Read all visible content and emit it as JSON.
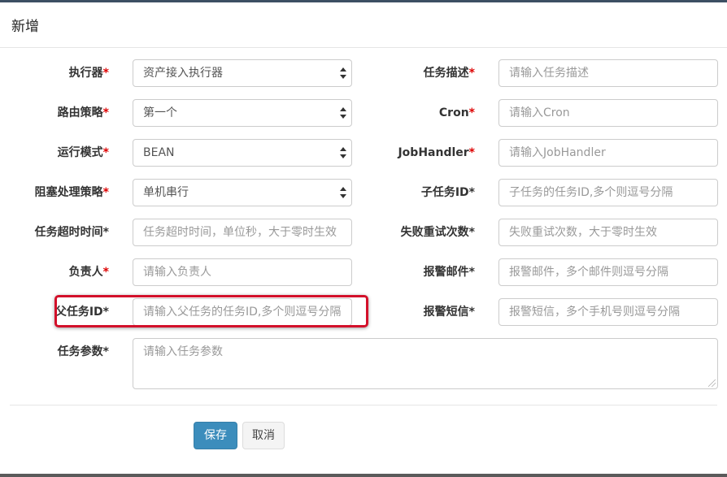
{
  "modal": {
    "title": "新增"
  },
  "required_mark": "*",
  "form": {
    "executor": {
      "label": "执行器",
      "value": "资产接入执行器"
    },
    "route_strategy": {
      "label": "路由策略",
      "value": "第一个"
    },
    "run_mode": {
      "label": "运行模式",
      "value": "BEAN"
    },
    "block_strategy": {
      "label": "阻塞处理策略",
      "value": "单机串行"
    },
    "timeout": {
      "label": "任务超时时间",
      "placeholder": "任务超时时间，单位秒，大于零时生效"
    },
    "owner": {
      "label": "负责人",
      "placeholder": "请输入负责人"
    },
    "parent_task_id": {
      "label": "父任务ID",
      "placeholder": "请输入父任务的任务ID,多个则逗号分隔"
    },
    "task_params": {
      "label": "任务参数",
      "placeholder": "请输入任务参数"
    },
    "task_desc": {
      "label": "任务描述",
      "placeholder": "请输入任务描述"
    },
    "cron": {
      "label": "Cron",
      "placeholder": "请输入Cron"
    },
    "job_handler": {
      "label": "JobHandler",
      "placeholder": "请输入JobHandler"
    },
    "child_task_id": {
      "label": "子任务ID",
      "placeholder": "子任务的任务ID,多个则逗号分隔"
    },
    "retry_count": {
      "label": "失败重试次数",
      "placeholder": "失败重试次数，大于零时生效"
    },
    "alarm_email": {
      "label": "报警邮件",
      "placeholder": "报警邮件，多个邮件则逗号分隔"
    },
    "alarm_sms": {
      "label": "报警短信",
      "placeholder": "报警短信，多个手机号则逗号分隔"
    }
  },
  "buttons": {
    "save": "保存",
    "cancel": "取消"
  },
  "colors": {
    "primary": "#3c8dbc",
    "required": "#dd0000",
    "highlight": "#d3102a"
  }
}
